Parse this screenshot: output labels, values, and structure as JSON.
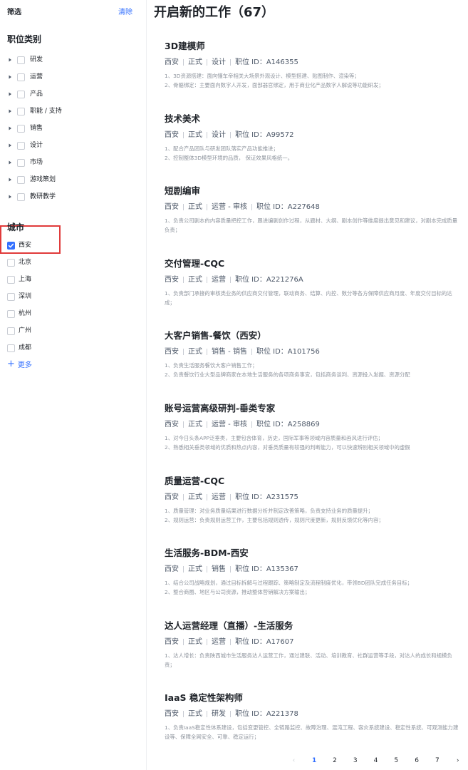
{
  "sidebar": {
    "filter_title": "筛选",
    "clear_label": "清除",
    "category_title": "职位类别",
    "categories": [
      "研发",
      "运营",
      "产品",
      "职能 / 支持",
      "销售",
      "设计",
      "市场",
      "游戏策划",
      "教研教学"
    ],
    "city_title": "城市",
    "cities": [
      {
        "label": "西安",
        "checked": true
      },
      {
        "label": "北京",
        "checked": false
      },
      {
        "label": "上海",
        "checked": false
      },
      {
        "label": "深圳",
        "checked": false
      },
      {
        "label": "杭州",
        "checked": false
      },
      {
        "label": "广州",
        "checked": false
      },
      {
        "label": "成都",
        "checked": false
      }
    ],
    "more_label": "更多"
  },
  "main": {
    "title": "开启新的工作（67）",
    "jobs": [
      {
        "title": "3D建模师",
        "tags": [
          "西安",
          "正式",
          "设计",
          "职位 ID：A146355"
        ],
        "desc": [
          "1、3D资源搭建：面向懂车帝相关大场景外观设计、模型搭建、贴图制作、渲染等；",
          "2、骨骼绑定：主要面向数字人开发，面部器官绑定，用于商业化产品数字人解说等功能研发；"
        ],
        "wrap": false
      },
      {
        "title": "技术美术",
        "tags": [
          "西安",
          "正式",
          "设计",
          "职位 ID：A99572"
        ],
        "desc": [
          "1、配合产品团队与研发团队落实产品功能推进；",
          "2、控制整体3D模型环境的品质， 保证效果风格统一。"
        ],
        "wrap": false
      },
      {
        "title": "短剧编审",
        "tags": [
          "西安",
          "正式",
          "运营 - 审核",
          "职位 ID：A227648"
        ],
        "desc": [
          "1、负责公司剧本的内容质量把控工作，跟进编剧创作过程，从题材、大纲、剧本创作等维度提出意见和建议，对剧本完成质量负责；"
        ],
        "wrap": true
      },
      {
        "title": "交付管理-CQC",
        "tags": [
          "西安",
          "正式",
          "运营",
          "职位 ID：A221276A"
        ],
        "desc": [
          "1、负责部门承接的审核类业务的供应商交付管理，联动商务、结算、内控、数分等各方保障供应商月度、年度交付目标的达成；"
        ],
        "wrap": true
      },
      {
        "title": "大客户销售-餐饮（西安）",
        "tags": [
          "西安",
          "正式",
          "销售 - 销售",
          "职位 ID：A101756"
        ],
        "desc": [
          "1、负责生活服务餐饮大客户销售工作；",
          "2、负责餐饮行业大型品牌商家在本地生活服务的各项商务事宜，包括商务谈判、资源投入发掘、资源分配"
        ],
        "wrap": false
      },
      {
        "title": "账号运营高级研判-垂类专家",
        "tags": [
          "西安",
          "正式",
          "运营 - 审核",
          "职位 ID：A258869"
        ],
        "desc": [
          "1、对今日头条APP泛垂类，主要包含体育，历史，国际军事等领域内容质量和画风进行评估；",
          "2、熟悉相关垂类领域的优质和热点内容，对垂类质量有较强的判断能力，可以快速辨别相关领域中的虚假"
        ],
        "wrap": false
      },
      {
        "title": "质量运营-CQC",
        "tags": [
          "西安",
          "正式",
          "运营",
          "职位 ID：A231575"
        ],
        "desc": [
          "1、质量管理：对业务质量结果进行数据分析并制定改善策略，负责支持业务的质量提升；",
          "2、规则运营：负责规则运营工作，主要包括规则透传，规则尺度更新，规则反馈优化等内容；"
        ],
        "wrap": false
      },
      {
        "title": "生活服务-BDM-西安",
        "tags": [
          "西安",
          "正式",
          "销售",
          "职位 ID：A135367"
        ],
        "desc": [
          "1、结合公司战略规划，通过目标拆解与过程跟踪、策略制定及流程制度优化，带领BD团队完成任务目标；",
          "2、整合商圈、地区与公司资源，推动整体营销解决方案输出；"
        ],
        "wrap": false
      },
      {
        "title": "达人运营经理（直播）-生活服务",
        "tags": [
          "西安",
          "正式",
          "运营",
          "职位 ID：A17607"
        ],
        "desc": [
          "1、达人增长：负责陕西城市生活服务达人运营工作，通过建联、活动、培训教育、社群运营等手段，对达人的成长和规模负责；"
        ],
        "wrap": true
      },
      {
        "title": "IaaS 稳定性架构师",
        "tags": [
          "西安",
          "正式",
          "研发",
          "职位 ID：A221378"
        ],
        "desc": [
          "1、负责IaaS稳定性体系建设，包括变更管控、全链路监控、故障治理、混沌工程、容灾系统建设、稳定性系统、可观测能力建设等、保障全网安全、可靠、稳定运行；"
        ],
        "wrap": true
      }
    ]
  },
  "pagination": {
    "prev": "‹",
    "pages": [
      "1",
      "2",
      "3",
      "4",
      "5",
      "6",
      "7"
    ],
    "active": "1",
    "next": "›"
  },
  "colors": {
    "accent": "#3370ff",
    "highlight_border": "#e03b3b"
  }
}
